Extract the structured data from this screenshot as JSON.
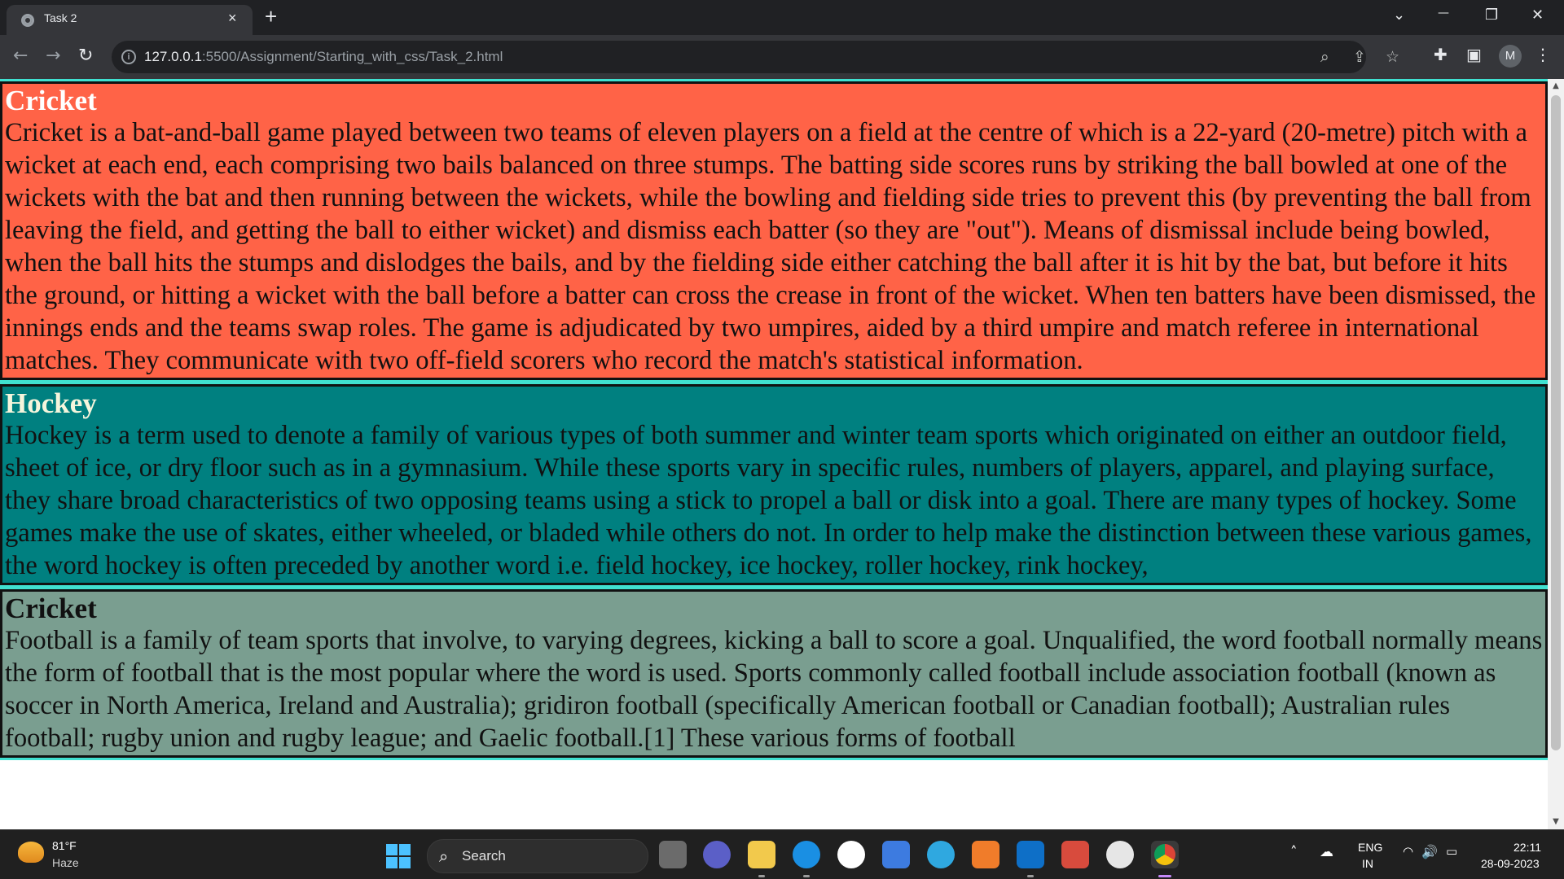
{
  "browser": {
    "tab_title": "Task 2",
    "tab_close": "×",
    "new_tab": "+",
    "url_host": "127.0.0.1",
    "url_rest": ":5500/Assignment/Starting_with_css/Task_2.html",
    "profile_initial": "M",
    "window_controls": {
      "dropdown": "⌄",
      "minimize": "—",
      "restore": "❐",
      "close": "✕"
    }
  },
  "sections": [
    {
      "heading": "Cricket",
      "text": "Cricket is a bat-and-ball game played between two teams of eleven players on a field at the centre of which is a 22-yard (20-metre) pitch with a wicket at each end, each comprising two bails balanced on three stumps. The batting side scores runs by striking the ball bowled at one of the wickets with the bat and then running between the wickets, while the bowling and fielding side tries to prevent this (by preventing the ball from leaving the field, and getting the ball to either wicket) and dismiss each batter (so they are \"out\"). Means of dismissal include being bowled, when the ball hits the stumps and dislodges the bails, and by the fielding side either catching the ball after it is hit by the bat, but before it hits the ground, or hitting a wicket with the ball before a batter can cross the crease in front of the wicket. When ten batters have been dismissed, the innings ends and the teams swap roles. The game is adjudicated by two umpires, aided by a third umpire and match referee in international matches. They communicate with two off-field scorers who record the match's statistical information."
    },
    {
      "heading": "Hockey",
      "text": "Hockey is a term used to denote a family of various types of both summer and winter team sports which originated on either an outdoor field, sheet of ice, or dry floor such as in a gymnasium. While these sports vary in specific rules, numbers of players, apparel, and playing surface, they share broad characteristics of two opposing teams using a stick to propel a ball or disk into a goal. There are many types of hockey. Some games make the use of skates, either wheeled, or bladed while others do not. In order to help make the distinction between these various games, the word hockey is often preceded by another word i.e. field hockey, ice hockey, roller hockey, rink hockey,"
    },
    {
      "heading": "Cricket",
      "text": "Football is a family of team sports that involve, to varying degrees, kicking a ball to score a goal. Unqualified, the word football normally means the form of football that is the most popular where the word is used. Sports commonly called football include association football (known as soccer in North America, Ireland and Australia); gridiron football (specifically American football or Canadian football); Australian rules football; rugby union and rugby league; and Gaelic football.[1] These various forms of football"
    }
  ],
  "taskbar": {
    "weather_temp": "81°F",
    "weather_desc": "Haze",
    "search_label": "Search",
    "lang_line1": "ENG",
    "lang_line2": "IN",
    "time": "22:11",
    "date": "28-09-2023"
  },
  "colors": {
    "cricket_bg": "#ff6347",
    "hockey_bg": "#008080",
    "football_bg": "#7a9e90",
    "section_outline": "#40e0d0"
  }
}
